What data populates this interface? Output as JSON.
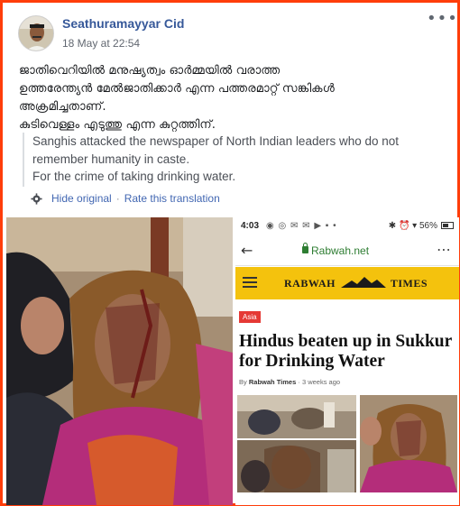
{
  "post": {
    "author": "Seathuramayyar Cid",
    "timestamp": "18 May at 22:54",
    "more_label": "•••",
    "original_text": [
      "ജാതിവെറിയിൽ മനുഷ്യത്വം ഓർമ്മയിൽ വരാത്ത",
      "ഉത്തരേന്ത്യൻ മേൽജാതിക്കാർ എന്ന പത്തരമാറ്റ് സങ്കികൾ",
      "അക്രമിച്ചതാണ്.",
      "കുടിവെള്ളം എടുത്തു എന്ന കുറ്റത്തിന്."
    ],
    "translation": [
      "Sanghis attacked the newspaper of North Indian leaders who do not",
      "remember humanity in caste.",
      "For the crime of taking drinking water."
    ],
    "hide_original_label": "Hide original",
    "separator": "·",
    "rate_translation_label": "Rate this translation",
    "icons": [
      "gear-icon",
      "more-options-icon"
    ]
  },
  "phone_screenshot": {
    "status_time": "4:03",
    "status_right": "✱ ⏰ ▾ 56%",
    "url": "Rabwah.net",
    "site_name_left": "RABWAH",
    "site_name_right": "TIMES",
    "category": "Asia",
    "headline": "Hindus beaten up in Sukkur for Drinking Water",
    "byline_prefix": "By",
    "byline_author": "Rabwah Times",
    "byline_time": "3 weeks ago",
    "colors": {
      "header_yellow": "#f4c20d",
      "badge_red": "#e53935",
      "url_green": "#2e7d32"
    }
  },
  "colors": {
    "frame_border": "#ff3d0a",
    "author_link": "#365899",
    "action_link": "#4267b2",
    "meta_gray": "#616770"
  }
}
